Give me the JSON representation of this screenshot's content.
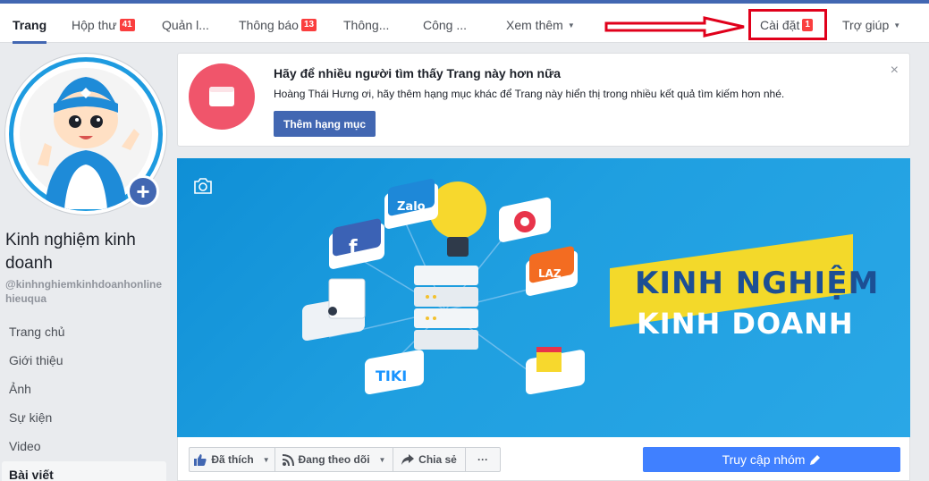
{
  "nav": {
    "tabs": [
      {
        "label": "Trang",
        "badge": ""
      },
      {
        "label": "Hộp thư",
        "badge": "41"
      },
      {
        "label": "Quản l...",
        "badge": ""
      },
      {
        "label": "Thông báo",
        "badge": "13"
      },
      {
        "label": "Thông...",
        "badge": ""
      },
      {
        "label": "Công ...",
        "badge": ""
      },
      {
        "label": "Xem thêm",
        "badge": ""
      },
      {
        "label": "Cài đặt",
        "badge": "1"
      },
      {
        "label": "Trợ giúp",
        "badge": ""
      }
    ],
    "accent_color": "#4267b2",
    "badge_color": "#fa3e3e",
    "annotation_color": "#e0001b"
  },
  "profile": {
    "name": "Kinh nghiệm kinh doanh",
    "handle": "@kinhnghiemkinhdoanhonlinehieuqua",
    "add_icon": "plus-icon"
  },
  "sidebar": {
    "items": [
      {
        "label": "Trang chủ"
      },
      {
        "label": "Giới thiệu"
      },
      {
        "label": "Ảnh"
      },
      {
        "label": "Sự kiện"
      },
      {
        "label": "Video"
      },
      {
        "label": "Bài viết"
      }
    ]
  },
  "notice": {
    "title": "Hãy để nhiều người tìm thấy Trang này hơn nữa",
    "body": "Hoàng Thái Hưng ơi, hãy thêm hạng mục khác để Trang này hiển thị trong nhiều kết quả tìm kiếm hơn nhé.",
    "button": "Thêm hạng mục",
    "close": "×"
  },
  "cover": {
    "line1": "KINH NGHIỆM",
    "line2": "KINH DOANH",
    "tiles": [
      "f",
      "Zalo",
      "LAZ",
      "TIKI"
    ]
  },
  "actions": {
    "liked": "Đã thích",
    "following": "Đang theo dõi",
    "share": "Chia sẻ",
    "more": "···",
    "visit": "Truy cập nhóm"
  }
}
